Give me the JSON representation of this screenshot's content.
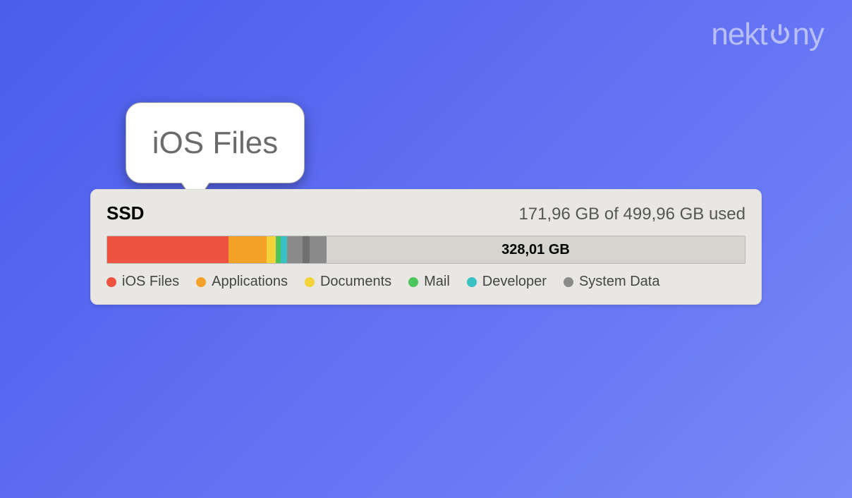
{
  "brand": "nektony",
  "tooltip": {
    "label": "iOS Files"
  },
  "storage": {
    "drive_name": "SSD",
    "summary": "171,96 GB of 499,96 GB used",
    "free_label": "328,01 GB",
    "categories": [
      {
        "name": "iOS Files",
        "color": "#ee5240"
      },
      {
        "name": "Applications",
        "color": "#f4a128"
      },
      {
        "name": "Documents",
        "color": "#f4d33a"
      },
      {
        "name": "Mail",
        "color": "#4bc45b"
      },
      {
        "name": "Developer",
        "color": "#3bc0c4"
      },
      {
        "name": "System Data",
        "color": "#8a8a8a"
      }
    ]
  },
  "chart_data": {
    "type": "bar",
    "title": "SSD storage usage",
    "total_gb": 499.96,
    "used_gb": 171.96,
    "free_gb": 328.01,
    "segments": [
      {
        "name": "iOS Files",
        "gb": 95,
        "color": "#ee5240"
      },
      {
        "name": "Applications",
        "gb": 30,
        "color": "#f4a128"
      },
      {
        "name": "Documents",
        "gb": 7,
        "color": "#f4d33a"
      },
      {
        "name": "Mail",
        "gb": 4,
        "color": "#4bc45b"
      },
      {
        "name": "Developer",
        "gb": 5,
        "color": "#3bc0c4"
      },
      {
        "name": "System Data",
        "gb": 12,
        "color": "#8a8a8a"
      },
      {
        "name": "System Data",
        "gb": 6,
        "color": "#6f6f6f"
      },
      {
        "name": "System Data",
        "gb": 13,
        "color": "#8a8a8a"
      }
    ]
  }
}
